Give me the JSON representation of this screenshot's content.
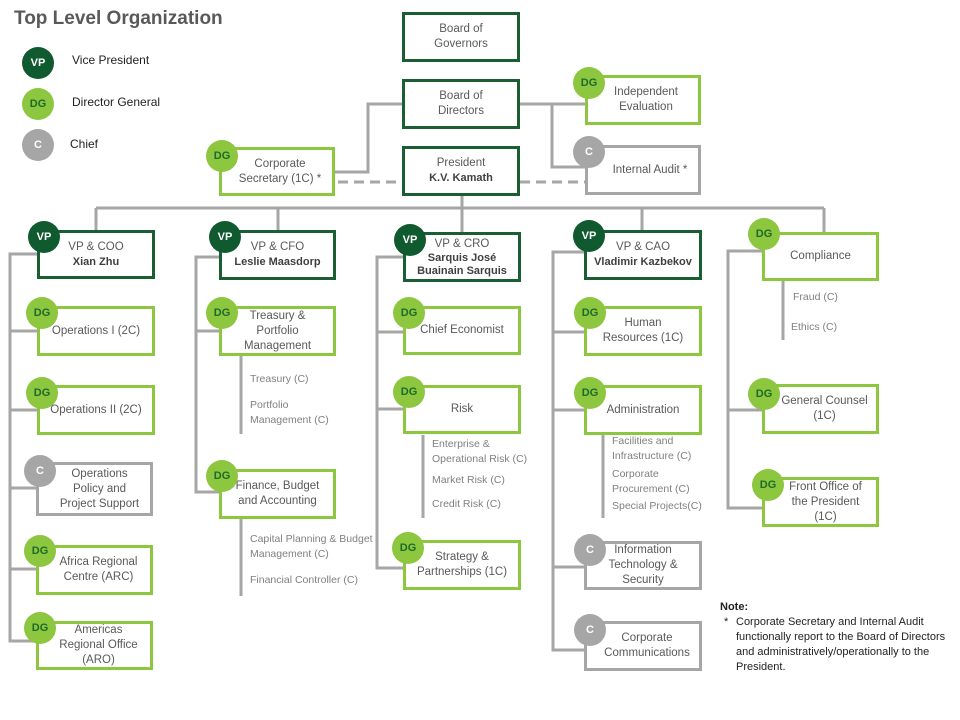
{
  "title": "Top Level Organization",
  "colors": {
    "vp": "#0f5a2e",
    "dg": "#8dc63f",
    "chief": "#a6a6a6",
    "connector": "#a6a6a6"
  },
  "legend": [
    {
      "badge": "VP",
      "label": "Vice President"
    },
    {
      "badge": "DG",
      "label": "Director General"
    },
    {
      "badge": "C",
      "label": "Chief"
    }
  ],
  "top": {
    "governors": "Board of Governors",
    "directors": "Board of Directors",
    "president_title": "President",
    "president_name": "K.V. Kamath",
    "corp_secretary": {
      "badge": "DG",
      "label": "Corporate Secretary (1C) *"
    },
    "independent_eval": {
      "badge": "DG",
      "label": "Independent Evaluation"
    },
    "internal_audit": {
      "badge": "C",
      "label": "Internal Audit *"
    }
  },
  "columns": [
    {
      "badge": "VP",
      "title": "VP & COO",
      "name": "Xian Zhu",
      "units": [
        {
          "badge": "DG",
          "label": "Operations I (2C)",
          "subs": []
        },
        {
          "badge": "DG",
          "label": "Operations II (2C)",
          "subs": []
        },
        {
          "badge": "C",
          "label": "Operations Policy and Project Support",
          "subs": []
        },
        {
          "badge": "DG",
          "label": "Africa Regional Centre  (ARC)",
          "subs": []
        },
        {
          "badge": "DG",
          "label": "Americas Regional Office (ARO)",
          "subs": []
        }
      ]
    },
    {
      "badge": "VP",
      "title": "VP & CFO",
      "name": "Leslie Maasdorp",
      "units": [
        {
          "badge": "DG",
          "label": "Treasury & Portfolio Management",
          "subs": [
            "Treasury (C)",
            "Portfolio Management (C)"
          ]
        },
        {
          "badge": "DG",
          "label": "Finance, Budget and Accounting",
          "subs": [
            "Capital Planning & Budget Management (C)",
            "Financial Controller (C)"
          ]
        }
      ]
    },
    {
      "badge": "VP",
      "title": "VP & CRO",
      "name": "Sarquis José Buainain Sarquis",
      "units": [
        {
          "badge": "DG",
          "label": "Chief Economist",
          "subs": []
        },
        {
          "badge": "DG",
          "label": "Risk",
          "subs": [
            "Enterprise & Operational Risk (C)",
            "Market Risk (C)",
            "Credit Risk  (C)"
          ]
        },
        {
          "badge": "DG",
          "label": "Strategy & Partnerships (1C)",
          "subs": []
        }
      ]
    },
    {
      "badge": "VP",
      "title": "VP & CAO",
      "name": "Vladimir Kazbekov",
      "units": [
        {
          "badge": "DG",
          "label": "Human Resources (1C)",
          "subs": []
        },
        {
          "badge": "DG",
          "label": "Administration",
          "subs": [
            "Facilities and Infrastructure (C)",
            "Corporate Procurement (C)",
            "Special Projects(C)"
          ]
        },
        {
          "badge": "C",
          "label": "Information Technology & Security",
          "subs": []
        },
        {
          "badge": "C",
          "label": "Corporate Communications",
          "subs": []
        }
      ]
    },
    {
      "badge": "DG",
      "title": "Compliance",
      "name": "",
      "subs": [
        "Fraud (C)",
        "Ethics (C)"
      ],
      "units": [
        {
          "badge": "DG",
          "label": "General Counsel (1C)",
          "subs": []
        },
        {
          "badge": "DG",
          "label": "Front Office of the President (1C)",
          "subs": []
        }
      ]
    }
  ],
  "note": {
    "heading": "Note:",
    "marker": "*",
    "text": "Corporate Secretary and Internal Audit functionally report to the Board of Directors and administratively/operationally to the President."
  }
}
